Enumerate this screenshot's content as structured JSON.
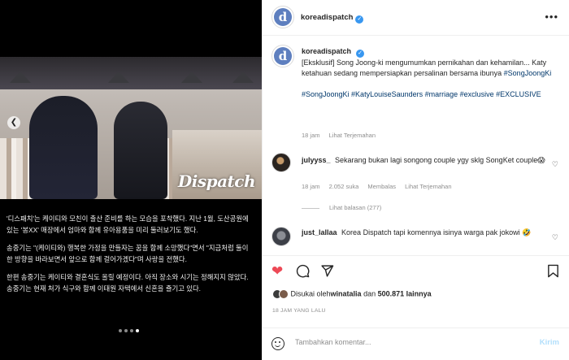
{
  "account": {
    "username": "koreadispatch",
    "avatar_letter": "d"
  },
  "left_panel": {
    "watermark": "Dispatch",
    "caption": [
      "'디스패치'는 케이티와 모친이 출산 준비를 하는 모습을 포착했다. 지난 1월, 도산공원에 있는 '봉XX' 매장에서 엄마와 함께 유아용품을 미리 둘러보기도 했다.",
      "송중기는 \"(케이티와) 행복한 가정을 만들자는 꿈을 함께 소망했다\"면서 \"지금처럼 둘이 한 방향을 바라보면서 앞으로 함께 걸어가겠다\"며 사랑을 전했다.",
      "한편 송중기는 케이티와 결혼식도 올릴 예정이다. 아직 장소와 시기는 정해지지 않았다. 송중기는 현재 처가 식구와 함께 이태원 자택에서 신혼을 즐기고 있다."
    ]
  },
  "post": {
    "caption_text": "[Eksklusif] Song Joong-ki mengumumkan pernikahan dan kehamilan... Katy ketahuan sedang mempersiapkan persalinan bersama ibunya",
    "caption_tag": "#SongJoongKi",
    "hashtags": "#SongJoongKi #KatyLouiseSaunders #marriage #exclusive #EXCLUSIVE",
    "time": "18 jam",
    "see_translation": "Lihat Terjemahan"
  },
  "comments": [
    {
      "username": "julyyss_",
      "text": "Sekarang bukan lagi songong couple ygy sklg SongKet couple😱",
      "time": "18 jam",
      "likes": "2.052 suka",
      "reply": "Membalas",
      "translate": "Lihat Terjemahan",
      "view_replies": "Lihat balasan (277)"
    },
    {
      "username": "just_lallaa",
      "text": "Korea Dispatch tapi komennya isinya warga pak jokowi 🤣"
    }
  ],
  "likes": {
    "prefix": "Disukai oleh",
    "user": "winatalia",
    "middle": " dan ",
    "count": "500.871 lainnya"
  },
  "time_ago": "18 JAM YANG LALU",
  "add_comment": {
    "placeholder": "Tambahkan komentar...",
    "post_label": "Kirim"
  },
  "icons": [
    "more-icon",
    "heart-icon",
    "comment-icon",
    "share-icon",
    "bookmark-icon",
    "emoji-icon",
    "verified-icon",
    "chevron-left-icon"
  ],
  "colors": {
    "link": "#00376b",
    "like_red": "#ed4956",
    "verified": "#3897f0",
    "muted": "#8e8e8e"
  }
}
